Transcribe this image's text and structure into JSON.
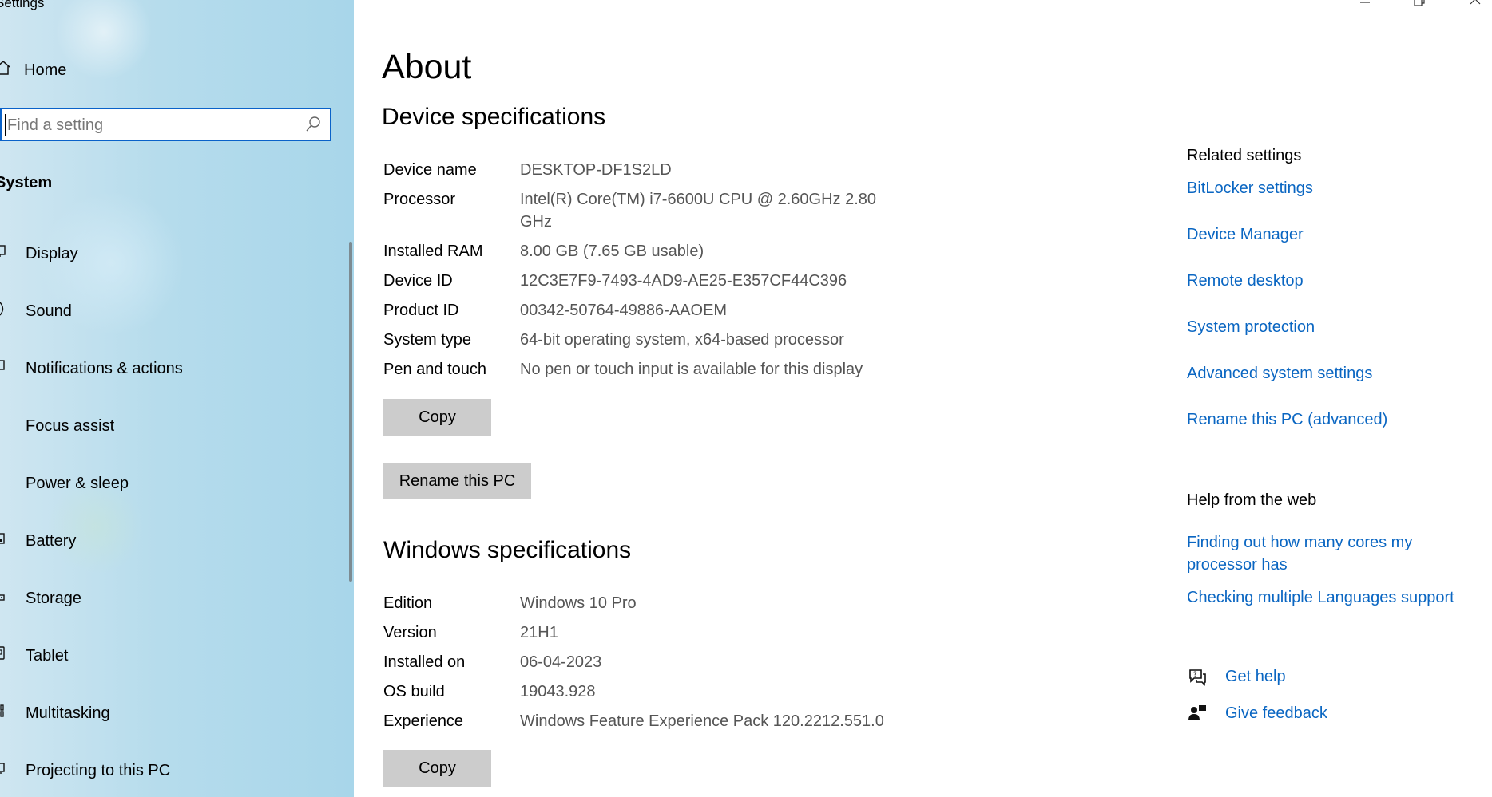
{
  "window": {
    "title": "Settings",
    "controls": {
      "minimize_icon": "minimize-icon",
      "maximize_icon": "restore-icon",
      "close_icon": "close-icon"
    }
  },
  "sidebar": {
    "home": {
      "label": "Home",
      "icon": "home-icon"
    },
    "search": {
      "placeholder": "Find a setting",
      "icon": "search-icon"
    },
    "section_label": "System",
    "items": [
      {
        "label": "Display",
        "icon": "display-icon"
      },
      {
        "label": "Sound",
        "icon": "sound-icon"
      },
      {
        "label": "Notifications & actions",
        "icon": "notifications-icon"
      },
      {
        "label": "Focus assist",
        "icon": "focus-assist-icon"
      },
      {
        "label": "Power & sleep",
        "icon": "power-icon"
      },
      {
        "label": "Battery",
        "icon": "battery-icon"
      },
      {
        "label": "Storage",
        "icon": "storage-icon"
      },
      {
        "label": "Tablet",
        "icon": "tablet-icon"
      },
      {
        "label": "Multitasking",
        "icon": "multitasking-icon"
      },
      {
        "label": "Projecting to this PC",
        "icon": "projecting-icon"
      }
    ]
  },
  "main": {
    "title": "About",
    "device_specs": {
      "heading": "Device specifications",
      "rows": [
        {
          "label": "Device name",
          "value": "DESKTOP-DF1S2LD"
        },
        {
          "label": "Processor",
          "value": "Intel(R) Core(TM) i7-6600U CPU @ 2.60GHz   2.80 GHz"
        },
        {
          "label": "Installed RAM",
          "value": "8.00 GB (7.65 GB usable)"
        },
        {
          "label": "Device ID",
          "value": "12C3E7F9-7493-4AD9-AE25-E357CF44C396"
        },
        {
          "label": "Product ID",
          "value": "00342-50764-49886-AAOEM"
        },
        {
          "label": "System type",
          "value": "64-bit operating system, x64-based processor"
        },
        {
          "label": "Pen and touch",
          "value": "No pen or touch input is available for this display"
        }
      ],
      "copy_label": "Copy",
      "rename_label": "Rename this PC"
    },
    "windows_specs": {
      "heading": "Windows specifications",
      "rows": [
        {
          "label": "Edition",
          "value": "Windows 10 Pro"
        },
        {
          "label": "Version",
          "value": "21H1"
        },
        {
          "label": "Installed on",
          "value": "06-04-2023"
        },
        {
          "label": "OS build",
          "value": "19043.928"
        },
        {
          "label": "Experience",
          "value": "Windows Feature Experience Pack 120.2212.551.0"
        }
      ],
      "copy_label": "Copy"
    }
  },
  "right": {
    "related_heading": "Related settings",
    "related_links": [
      "BitLocker settings",
      "Device Manager",
      "Remote desktop",
      "System protection",
      "Advanced system settings",
      "Rename this PC (advanced)"
    ],
    "help_heading": "Help from the web",
    "help_links": [
      "Finding out how many cores my processor has",
      "Checking multiple Languages support"
    ],
    "get_help": {
      "label": "Get help",
      "icon": "get-help-icon"
    },
    "give_feedback": {
      "label": "Give feedback",
      "icon": "feedback-icon"
    }
  },
  "colors": {
    "accent": "#0a66c2",
    "search_border": "#0a62c9",
    "button_bg": "#cccccc",
    "value_text": "#555555"
  }
}
